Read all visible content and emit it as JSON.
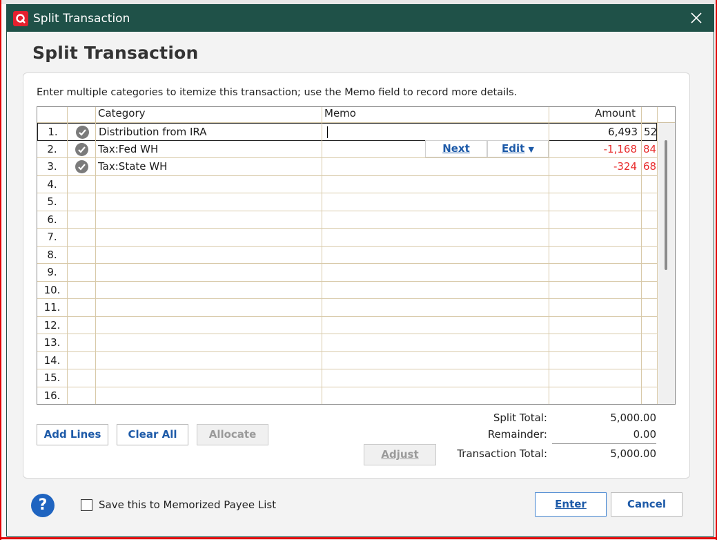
{
  "window": {
    "title": "Split Transaction"
  },
  "heading": "Split Transaction",
  "instructions": "Enter multiple categories to itemize this transaction; use the Memo field to record more details.",
  "columns": {
    "category": "Category",
    "memo": "Memo",
    "amount": "Amount"
  },
  "rows": [
    {
      "num": "1.",
      "category": "Distribution from IRA",
      "memo": "",
      "amount": "6,493",
      "cents": "52",
      "negative": false,
      "checked": true
    },
    {
      "num": "2.",
      "category": "Tax:Fed WH",
      "memo": "",
      "amount": "-1,168",
      "cents": "84",
      "negative": true,
      "checked": true
    },
    {
      "num": "3.",
      "category": "Tax:State WH",
      "memo": "",
      "amount": "-324",
      "cents": "68",
      "negative": true,
      "checked": true
    },
    {
      "num": "4.",
      "category": "",
      "memo": "",
      "amount": "",
      "cents": ""
    },
    {
      "num": "5.",
      "category": "",
      "memo": "",
      "amount": "",
      "cents": ""
    },
    {
      "num": "6.",
      "category": "",
      "memo": "",
      "amount": "",
      "cents": ""
    },
    {
      "num": "7.",
      "category": "",
      "memo": "",
      "amount": "",
      "cents": ""
    },
    {
      "num": "8.",
      "category": "",
      "memo": "",
      "amount": "",
      "cents": ""
    },
    {
      "num": "9.",
      "category": "",
      "memo": "",
      "amount": "",
      "cents": ""
    },
    {
      "num": "10.",
      "category": "",
      "memo": "",
      "amount": "",
      "cents": ""
    },
    {
      "num": "11.",
      "category": "",
      "memo": "",
      "amount": "",
      "cents": ""
    },
    {
      "num": "12.",
      "category": "",
      "memo": "",
      "amount": "",
      "cents": ""
    },
    {
      "num": "13.",
      "category": "",
      "memo": "",
      "amount": "",
      "cents": ""
    },
    {
      "num": "14.",
      "category": "",
      "memo": "",
      "amount": "",
      "cents": ""
    },
    {
      "num": "15.",
      "category": "",
      "memo": "",
      "amount": "",
      "cents": ""
    },
    {
      "num": "16.",
      "category": "",
      "memo": "",
      "amount": "",
      "cents": ""
    }
  ],
  "row_actions": {
    "next": "Next",
    "edit": "Edit"
  },
  "buttons": {
    "add_lines": "Add Lines",
    "clear_all": "Clear All",
    "allocate": "Allocate",
    "adjust": "Adjust",
    "enter": "Enter",
    "cancel": "Cancel"
  },
  "totals": {
    "split_total_label": "Split Total:",
    "split_total": "5,000.00",
    "remainder_label": "Remainder:",
    "remainder": "0.00",
    "transaction_total_label": "Transaction Total:",
    "transaction_total": "5,000.00"
  },
  "footer": {
    "memorize_label": "Save this to Memorized Payee List",
    "memorize_checked": false
  },
  "colors": {
    "titlebar": "#1f5148",
    "accent": "#1d5aa8",
    "negative": "#e82c2c",
    "logo": "#e5202e"
  }
}
